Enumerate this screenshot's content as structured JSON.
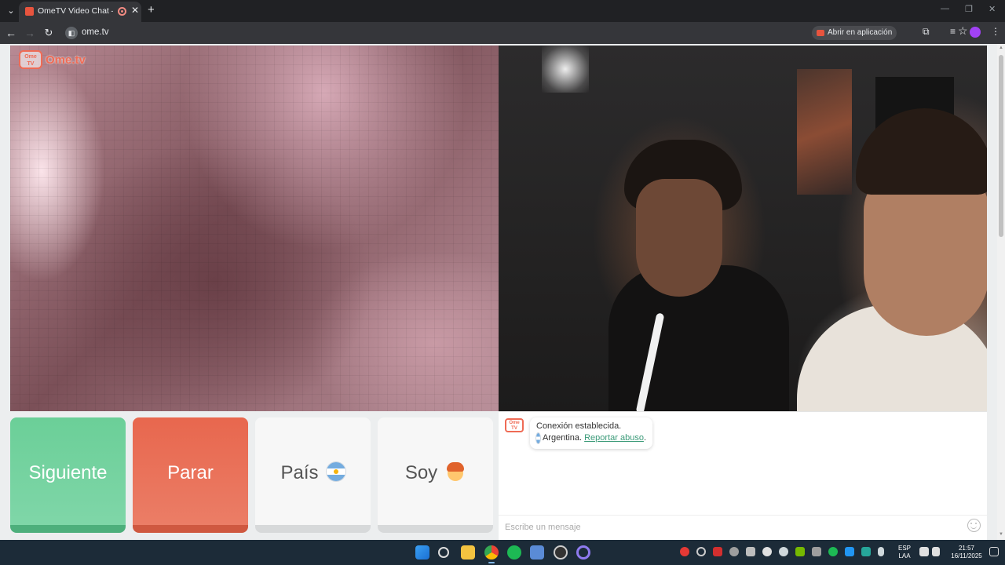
{
  "browser": {
    "tab_title": "OmeTV Video Chat — Omegle",
    "url": "ome.tv",
    "open_in_app": "Abrir en aplicación"
  },
  "logo": {
    "small": "Ome TV",
    "text": "Ome.tv"
  },
  "controls": {
    "next": "Siguiente",
    "stop": "Parar",
    "country": "País",
    "me": "Soy"
  },
  "chat": {
    "connection": "Conexión establecida.",
    "country": "Argentina.",
    "report": "Reportar abuso",
    "report_suffix": ".",
    "placeholder": "Escribe un mensaje"
  },
  "taskbar": {
    "lang_1": "ESP",
    "lang_2": "LAA",
    "time": "21:57",
    "date": "16/11/2025"
  },
  "colors": {
    "next_button": "#6bcf98",
    "stop_button": "#e8674e",
    "brand": "#ef6b55",
    "link": "#3a9a78"
  }
}
